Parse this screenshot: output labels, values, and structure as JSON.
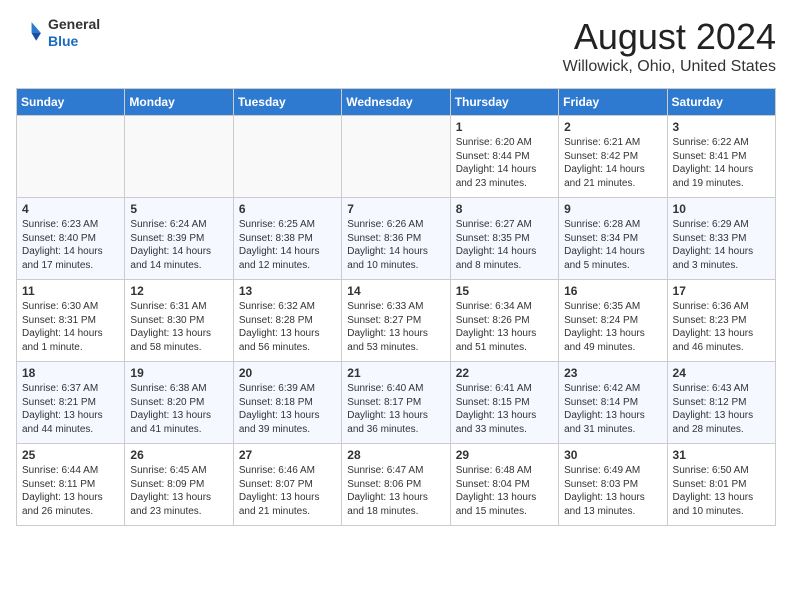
{
  "header": {
    "logo_line1": "General",
    "logo_line2": "Blue",
    "month_title": "August 2024",
    "location": "Willowick, Ohio, United States"
  },
  "days_of_week": [
    "Sunday",
    "Monday",
    "Tuesday",
    "Wednesday",
    "Thursday",
    "Friday",
    "Saturday"
  ],
  "weeks": [
    [
      {
        "day": "",
        "info": ""
      },
      {
        "day": "",
        "info": ""
      },
      {
        "day": "",
        "info": ""
      },
      {
        "day": "",
        "info": ""
      },
      {
        "day": "1",
        "info": "Sunrise: 6:20 AM\nSunset: 8:44 PM\nDaylight: 14 hours\nand 23 minutes."
      },
      {
        "day": "2",
        "info": "Sunrise: 6:21 AM\nSunset: 8:42 PM\nDaylight: 14 hours\nand 21 minutes."
      },
      {
        "day": "3",
        "info": "Sunrise: 6:22 AM\nSunset: 8:41 PM\nDaylight: 14 hours\nand 19 minutes."
      }
    ],
    [
      {
        "day": "4",
        "info": "Sunrise: 6:23 AM\nSunset: 8:40 PM\nDaylight: 14 hours\nand 17 minutes."
      },
      {
        "day": "5",
        "info": "Sunrise: 6:24 AM\nSunset: 8:39 PM\nDaylight: 14 hours\nand 14 minutes."
      },
      {
        "day": "6",
        "info": "Sunrise: 6:25 AM\nSunset: 8:38 PM\nDaylight: 14 hours\nand 12 minutes."
      },
      {
        "day": "7",
        "info": "Sunrise: 6:26 AM\nSunset: 8:36 PM\nDaylight: 14 hours\nand 10 minutes."
      },
      {
        "day": "8",
        "info": "Sunrise: 6:27 AM\nSunset: 8:35 PM\nDaylight: 14 hours\nand 8 minutes."
      },
      {
        "day": "9",
        "info": "Sunrise: 6:28 AM\nSunset: 8:34 PM\nDaylight: 14 hours\nand 5 minutes."
      },
      {
        "day": "10",
        "info": "Sunrise: 6:29 AM\nSunset: 8:33 PM\nDaylight: 14 hours\nand 3 minutes."
      }
    ],
    [
      {
        "day": "11",
        "info": "Sunrise: 6:30 AM\nSunset: 8:31 PM\nDaylight: 14 hours\nand 1 minute."
      },
      {
        "day": "12",
        "info": "Sunrise: 6:31 AM\nSunset: 8:30 PM\nDaylight: 13 hours\nand 58 minutes."
      },
      {
        "day": "13",
        "info": "Sunrise: 6:32 AM\nSunset: 8:28 PM\nDaylight: 13 hours\nand 56 minutes."
      },
      {
        "day": "14",
        "info": "Sunrise: 6:33 AM\nSunset: 8:27 PM\nDaylight: 13 hours\nand 53 minutes."
      },
      {
        "day": "15",
        "info": "Sunrise: 6:34 AM\nSunset: 8:26 PM\nDaylight: 13 hours\nand 51 minutes."
      },
      {
        "day": "16",
        "info": "Sunrise: 6:35 AM\nSunset: 8:24 PM\nDaylight: 13 hours\nand 49 minutes."
      },
      {
        "day": "17",
        "info": "Sunrise: 6:36 AM\nSunset: 8:23 PM\nDaylight: 13 hours\nand 46 minutes."
      }
    ],
    [
      {
        "day": "18",
        "info": "Sunrise: 6:37 AM\nSunset: 8:21 PM\nDaylight: 13 hours\nand 44 minutes."
      },
      {
        "day": "19",
        "info": "Sunrise: 6:38 AM\nSunset: 8:20 PM\nDaylight: 13 hours\nand 41 minutes."
      },
      {
        "day": "20",
        "info": "Sunrise: 6:39 AM\nSunset: 8:18 PM\nDaylight: 13 hours\nand 39 minutes."
      },
      {
        "day": "21",
        "info": "Sunrise: 6:40 AM\nSunset: 8:17 PM\nDaylight: 13 hours\nand 36 minutes."
      },
      {
        "day": "22",
        "info": "Sunrise: 6:41 AM\nSunset: 8:15 PM\nDaylight: 13 hours\nand 33 minutes."
      },
      {
        "day": "23",
        "info": "Sunrise: 6:42 AM\nSunset: 8:14 PM\nDaylight: 13 hours\nand 31 minutes."
      },
      {
        "day": "24",
        "info": "Sunrise: 6:43 AM\nSunset: 8:12 PM\nDaylight: 13 hours\nand 28 minutes."
      }
    ],
    [
      {
        "day": "25",
        "info": "Sunrise: 6:44 AM\nSunset: 8:11 PM\nDaylight: 13 hours\nand 26 minutes."
      },
      {
        "day": "26",
        "info": "Sunrise: 6:45 AM\nSunset: 8:09 PM\nDaylight: 13 hours\nand 23 minutes."
      },
      {
        "day": "27",
        "info": "Sunrise: 6:46 AM\nSunset: 8:07 PM\nDaylight: 13 hours\nand 21 minutes."
      },
      {
        "day": "28",
        "info": "Sunrise: 6:47 AM\nSunset: 8:06 PM\nDaylight: 13 hours\nand 18 minutes."
      },
      {
        "day": "29",
        "info": "Sunrise: 6:48 AM\nSunset: 8:04 PM\nDaylight: 13 hours\nand 15 minutes."
      },
      {
        "day": "30",
        "info": "Sunrise: 6:49 AM\nSunset: 8:03 PM\nDaylight: 13 hours\nand 13 minutes."
      },
      {
        "day": "31",
        "info": "Sunrise: 6:50 AM\nSunset: 8:01 PM\nDaylight: 13 hours\nand 10 minutes."
      }
    ]
  ]
}
